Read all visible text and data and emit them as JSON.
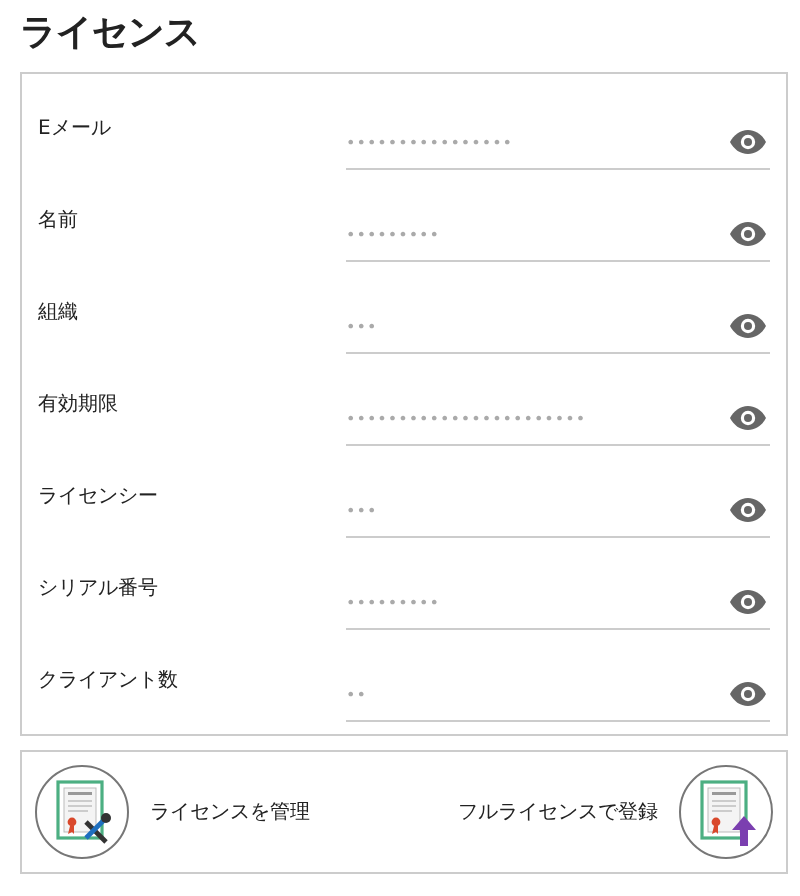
{
  "title": "ライセンス",
  "fields": [
    {
      "label": "Eメール",
      "value": "••••••••••••••••"
    },
    {
      "label": "名前",
      "value": "•••••••••"
    },
    {
      "label": "組織",
      "value": "•••"
    },
    {
      "label": "有効期限",
      "value": "•••••••••••••••••••••••"
    },
    {
      "label": "ライセンシー",
      "value": "•••"
    },
    {
      "label": "シリアル番号",
      "value": "•••••••••"
    },
    {
      "label": "クライアント数",
      "value": "••"
    }
  ],
  "actions": [
    {
      "kind": "manage",
      "label": "ライセンスを管理"
    },
    {
      "kind": "upgrade",
      "label": "フルライセンスで登録"
    }
  ]
}
